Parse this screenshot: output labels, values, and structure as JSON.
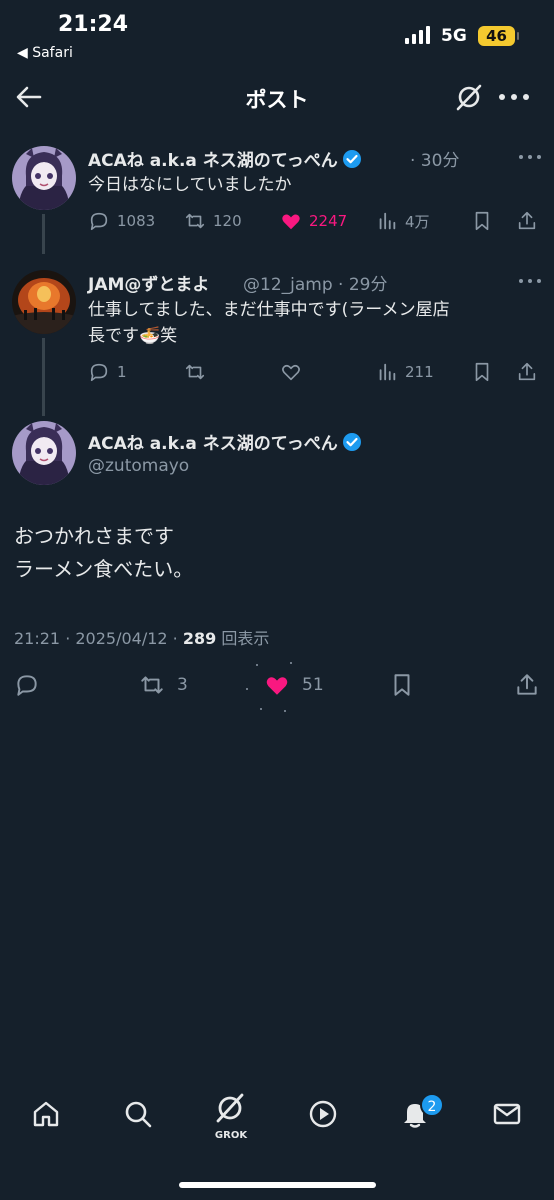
{
  "status_bar": {
    "time": "21:24",
    "back_app": "◀ Safari",
    "network": "5G",
    "battery": "46"
  },
  "header": {
    "title": "ポスト"
  },
  "tweets": [
    {
      "display_name": "ACAね a.k.a ネス湖のてっぺん",
      "time": "· 30分",
      "text": "今日はなにしていましたか",
      "stats": {
        "replies": "1083",
        "reposts": "120",
        "likes": "2247",
        "views": "4万"
      }
    },
    {
      "display_name": "JAM@ずとまよ",
      "handle_time": "@12_jamp · 29分",
      "text_line1": "仕事してました、まだ仕事中です(ラーメン屋店",
      "text_line2": "長です🍜笑",
      "stats": {
        "replies": "1",
        "views": "211"
      }
    }
  ],
  "main_post": {
    "display_name": "ACAね a.k.a ネス湖のてっぺん",
    "handle": "@zutomayo",
    "text_line1": "おつかれさまです",
    "text_line2": "ラーメン食べたい。",
    "timestamp": "21:21 · 2025/04/12 · ",
    "views_count": "289",
    "views_label": " 回表示",
    "reposts": "3",
    "likes": "51"
  },
  "nav": {
    "grok_label": "GROK",
    "notifications_badge": "2"
  },
  "colors": {
    "background": "#15202b",
    "like": "#f91880",
    "verified": "#1d9bf0",
    "muted": "#8b98a5"
  }
}
